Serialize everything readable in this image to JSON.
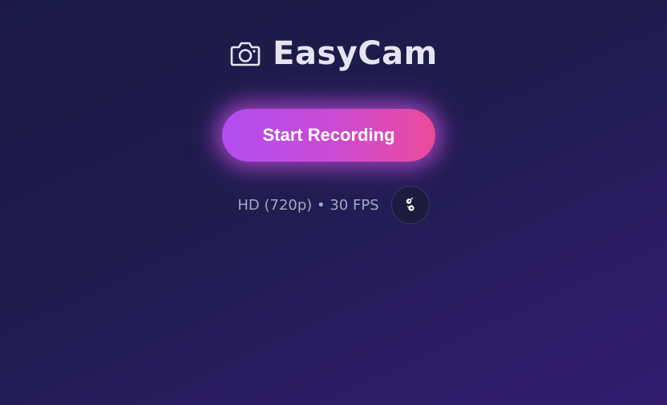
{
  "app": {
    "title": "EasyCam",
    "icon": "camera-icon"
  },
  "record_button": {
    "label": "Start Recording"
  },
  "status": {
    "text": "HD (720p) • 30 FPS"
  },
  "settings_button": {
    "icon": "settings-icon"
  },
  "colors": {
    "background_start": "#1c1a45",
    "background_end": "#321b6e",
    "button_gradient_start": "#b14df0",
    "button_gradient_end": "#ec4a9a",
    "title_text": "#e6e4f1",
    "status_text": "#a8a4c4"
  }
}
